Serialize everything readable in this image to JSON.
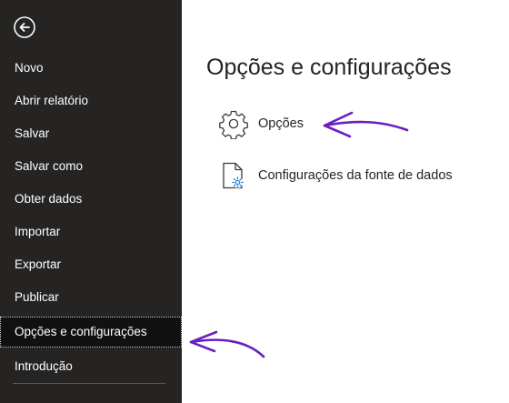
{
  "sidebar": {
    "back_icon": "back-arrow-icon",
    "items": [
      {
        "label": "Novo"
      },
      {
        "label": "Abrir relatório"
      },
      {
        "label": "Salvar"
      },
      {
        "label": "Salvar como"
      },
      {
        "label": "Obter dados"
      },
      {
        "label": "Importar"
      },
      {
        "label": "Exportar"
      },
      {
        "label": "Publicar"
      },
      {
        "label": "Opções e configurações",
        "selected": true
      },
      {
        "label": "Introdução"
      }
    ]
  },
  "main": {
    "title": "Opções e configurações",
    "options": [
      {
        "label": "Opções",
        "icon": "gear-icon"
      },
      {
        "label": "Configurações da fonte de dados",
        "icon": "data-source-settings-icon"
      }
    ]
  },
  "colors": {
    "sidebar_bg": "#252423",
    "selected_bg": "#111111",
    "annotation": "#6a1fc2",
    "icon_accent": "#2b88d8"
  }
}
